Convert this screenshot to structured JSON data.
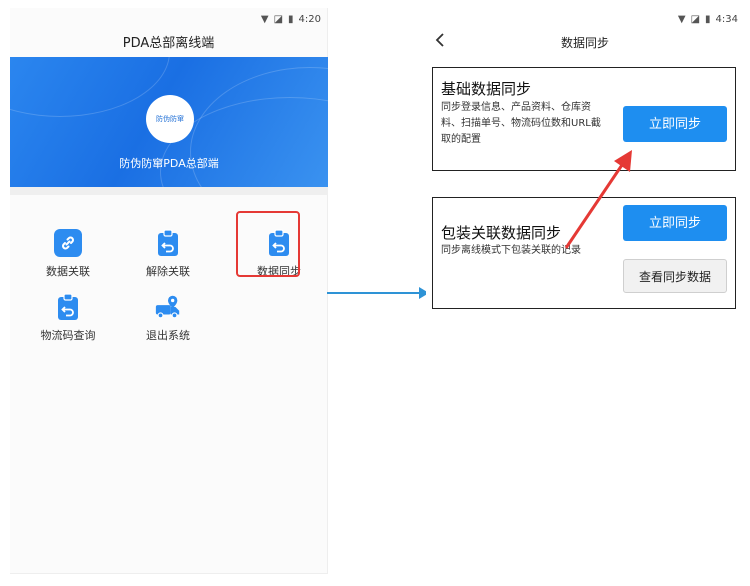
{
  "left_screen": {
    "status_time": "4:20",
    "title": "PDA总部离线端",
    "banner": {
      "logo_text": "防伪防窜",
      "text": "防伪防窜PDA总部端"
    },
    "menu": [
      {
        "label": "数据关联",
        "icon": "link-icon"
      },
      {
        "label": "解除关联",
        "icon": "clipboard-undo-icon"
      },
      {
        "label": "数据同步",
        "icon": "clipboard-sync-icon"
      },
      {
        "label": "物流码查询",
        "icon": "clipboard-search-icon"
      },
      {
        "label": "退出系统",
        "icon": "truck-location-icon"
      }
    ]
  },
  "right_screen": {
    "status_time": "4:34",
    "title": "数据同步",
    "sections": [
      {
        "title": "基础数据同步",
        "description_lines": [
          "同步登录信息、产品资料、仓库资",
          "料、扫描单号、物流码位数和URL截",
          "取的配置"
        ],
        "button_label": "立即同步"
      },
      {
        "title": "包装关联数据同步",
        "description_lines": [
          "同步离线模式下包装关联的记录"
        ],
        "button_label": "立即同步",
        "secondary_button_label": "查看同步数据"
      }
    ]
  },
  "colors": {
    "accent": "#1e8ef0",
    "banner": "#2b86ef",
    "highlight": "#e53935",
    "connector": "#2e93d6"
  }
}
